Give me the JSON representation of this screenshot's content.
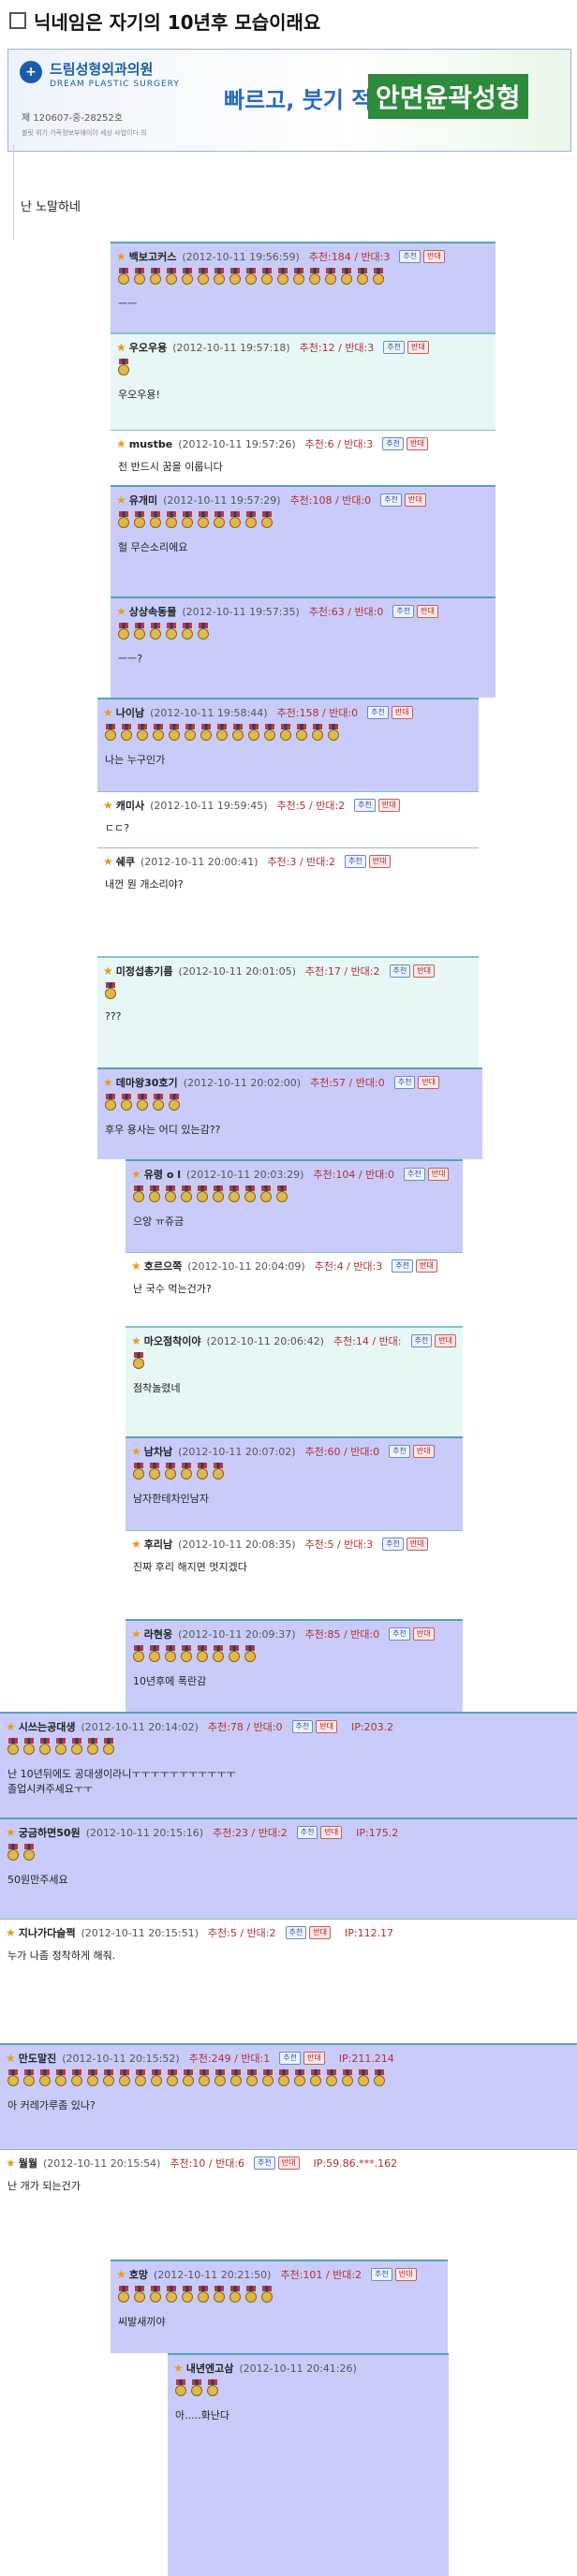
{
  "page": {
    "title": "닉네임은 자기의 10년후 모습이래요"
  },
  "banner": {
    "clinic_name": "드림성형외과의원",
    "clinic_eng": "DREAM PLASTIC SURGERY",
    "reg_no": "제 120607-중-28252호",
    "address": "블릿 위기 가족정보부에이이 세상 사업이다 의",
    "slogan": "빠르고, 붓기 적은",
    "highlight": "안면윤곽성형"
  },
  "post": {
    "body": "난 노말하네"
  },
  "labels": {
    "recommend": "추천",
    "oppose": "반대"
  },
  "colors": {
    "blue_box": "#c9ccfb",
    "green_box": "#e6f7f6",
    "accent": "#e89a1c",
    "vote": "#b03030"
  },
  "comments": [
    {
      "nick": "백보고커스",
      "date": "(2012-10-11 19:56:59)",
      "vote": "추천:184 / 반대:3",
      "ip": "",
      "text": "ㅡㅡ",
      "medals": 17
    },
    {
      "nick": "우오우용",
      "date": "(2012-10-11 19:57:18)",
      "vote": "추천:12 / 반대:3",
      "ip": "",
      "text": "우오우용!",
      "medals": 1
    },
    {
      "nick": "mustbe",
      "date": "(2012-10-11 19:57:26)",
      "vote": "추천:6 / 반대:3",
      "ip": "",
      "text": "전 반드시 꿈을 이룹니다",
      "medals": 0
    },
    {
      "nick": "유개미",
      "date": "(2012-10-11 19:57:29)",
      "vote": "추천:108 / 반대:0",
      "ip": "",
      "text": "헐 무슨소리에요",
      "medals": 10
    },
    {
      "nick": "상상속동물",
      "date": "(2012-10-11 19:57:35)",
      "vote": "추천:63 / 반대:0",
      "ip": "",
      "text": "ㅡㅡ?",
      "medals": 6
    },
    {
      "nick": "나이남",
      "date": "(2012-10-11 19:58:44)",
      "vote": "추천:158 / 반대:0",
      "ip": "",
      "text": "나는 누구인가",
      "medals": 15
    },
    {
      "nick": "캐미사",
      "date": "(2012-10-11 19:59:45)",
      "vote": "추천:5 / 반대:2",
      "ip": "",
      "text": "ㄷㄷ?",
      "medals": 0
    },
    {
      "nick": "쉐쿠",
      "date": "(2012-10-11 20:00:41)",
      "vote": "추천:3 / 반대:2",
      "ip": "",
      "text": "내껀 뭔 개소리야?",
      "medals": 0
    },
    {
      "nick": "미정섭총기름",
      "date": "(2012-10-11 20:01:05)",
      "vote": "추천:17 / 반대:2",
      "ip": "",
      "text": "???",
      "medals": 1
    },
    {
      "nick": "데마왕30호기",
      "date": "(2012-10-11 20:02:00)",
      "vote": "추천:57 / 반대:0",
      "ip": "",
      "text": "후우 용사는 어디 있는감??",
      "medals": 5
    },
    {
      "nick": "유령 o l",
      "date": "(2012-10-11 20:03:29)",
      "vote": "추천:104 / 반대:0",
      "ip": "",
      "text": "으앙 ㅠ쥬금",
      "medals": 10
    },
    {
      "nick": "호르으쪽",
      "date": "(2012-10-11 20:04:09)",
      "vote": "추천:4 / 반대:3",
      "ip": "",
      "text": "난 국수 먹는건가?",
      "medals": 0
    },
    {
      "nick": "마오점착이야",
      "date": "(2012-10-11 20:06:42)",
      "vote": "추천:14 / 반대:",
      "ip": "",
      "text": "점착놀렸네",
      "medals": 1
    },
    {
      "nick": "남차남",
      "date": "(2012-10-11 20:07:02)",
      "vote": "추천:60 / 반대:0",
      "ip": "",
      "text": "남자한테차인남자",
      "medals": 6
    },
    {
      "nick": "후리남",
      "date": "(2012-10-11 20:08:35)",
      "vote": "추천:5 / 반대:3",
      "ip": "",
      "text": "진짜 후리 해지면 멋지겠다",
      "medals": 0
    },
    {
      "nick": "라현웅",
      "date": "(2012-10-11 20:09:37)",
      "vote": "추천:85 / 반대:0",
      "ip": "",
      "text": "10년후에 폭란감",
      "medals": 8
    },
    {
      "nick": "시쓰는공대생",
      "date": "(2012-10-11 20:14:02)",
      "vote": "추천:78 / 반대:0",
      "ip": "IP:203.2",
      "text": "난 10년뒤에도 공대생이라니ㅜㅜㅜㅜㅜㅜㅜㅜㅜㅜㅜ",
      "text2": "졸업시켜주세요ㅜㅜ",
      "medals": 7
    },
    {
      "nick": "궁금하면50원",
      "date": "(2012-10-11 20:15:16)",
      "vote": "추천:23 / 반대:2",
      "ip": "IP:175.2",
      "text": "50원만주세요",
      "medals": 2
    },
    {
      "nick": "지나가다슬쩍",
      "date": "(2012-10-11 20:15:51)",
      "vote": "추천:5 / 반대:2",
      "ip": "IP:112.17",
      "text": "누가 나좀 정착하게 해줘.",
      "medals": 0
    },
    {
      "nick": "만도말진",
      "date": "(2012-10-11 20:15:52)",
      "vote": "추천:249 / 반대:1",
      "ip": "IP:211.214",
      "text": "아 커레가루좀 있나?",
      "medals": 24
    },
    {
      "nick": "월월",
      "date": "(2012-10-11 20:15:54)",
      "vote": "추천:10 / 반대:6",
      "ip": "IP:59.86.***.162",
      "text": "난 개가 되는건가",
      "medals": 0
    },
    {
      "nick": "호망",
      "date": "(2012-10-11 20:21:50)",
      "vote": "추천:101 / 반대:2",
      "ip": "",
      "text": "씨발새끼야",
      "medals": 10
    },
    {
      "nick": "내년엔고삼",
      "date": "(2012-10-11 20:41:26)",
      "vote": "",
      "ip": "",
      "text": "아.....화난다",
      "medals": 3
    }
  ]
}
